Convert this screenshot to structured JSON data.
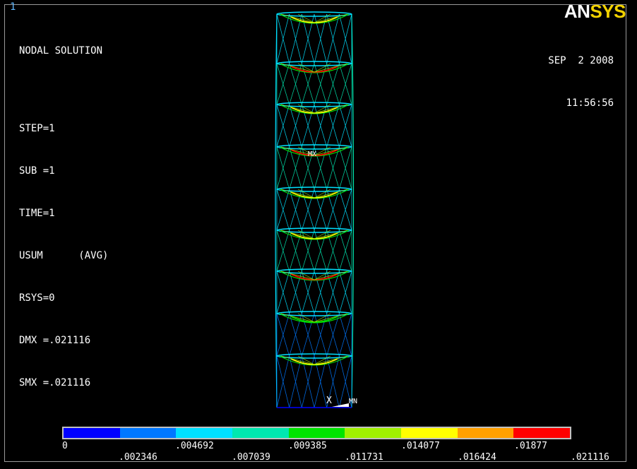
{
  "window_number": "1",
  "info": {
    "title": "NODAL SOLUTION",
    "step": "STEP=1",
    "sub": "SUB =1",
    "time": "TIME=1",
    "usum": "USUM      (AVG)",
    "rsys": "RSYS=0",
    "dmx": "DMX =.021116",
    "smx": "SMX =.021116"
  },
  "logo": {
    "part1": "AN",
    "part2": "SYS"
  },
  "datetime": {
    "date": "SEP  2 2008",
    "time": "11:56:56"
  },
  "triad": {
    "x_label": "X",
    "min_label": "MN",
    "max_label": "MX"
  },
  "legend": {
    "colors": [
      "#0000ff",
      "#0078ff",
      "#00e0ff",
      "#00e8b0",
      "#00e400",
      "#a0f000",
      "#ffff00",
      "#ffa000",
      "#ff0000"
    ],
    "top_labels": [
      "0",
      ".004692",
      ".009385",
      ".014077",
      ".01877"
    ],
    "bottom_labels": [
      ".002346",
      ".007039",
      ".011731",
      ".016424",
      ".021116"
    ]
  }
}
